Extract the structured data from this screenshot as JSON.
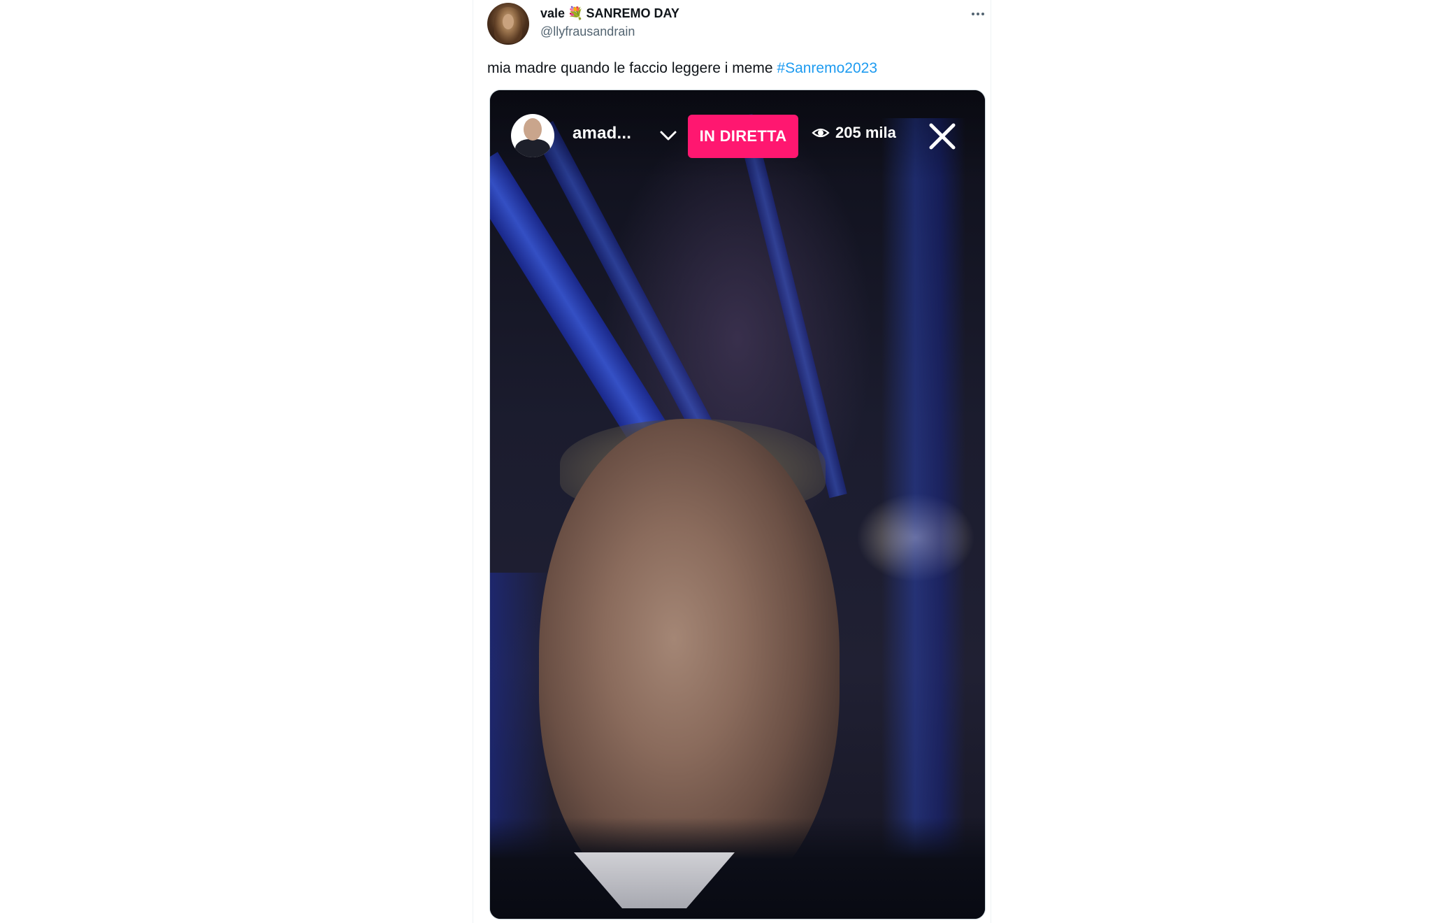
{
  "tweet": {
    "author": {
      "name": "vale",
      "name_emoji": "💐",
      "name_suffix": "SANREMO DAY",
      "handle": "@llyfrausandrain"
    },
    "text": "mia madre quando le faccio leggere i meme ",
    "hashtag": "#Sanremo2023",
    "more_icon": "more-horizontal-icon"
  },
  "media": {
    "live": {
      "username": "amad...",
      "badge": "IN DIRETTA",
      "viewers": "205 mila",
      "badge_color": "#ff1770",
      "icons": [
        "chevron-down-icon",
        "eye-icon",
        "close-icon"
      ]
    }
  },
  "colors": {
    "link": "#1d9bf0",
    "text_primary": "#0f1419",
    "text_secondary": "#536471",
    "border": "#cfd9de"
  }
}
